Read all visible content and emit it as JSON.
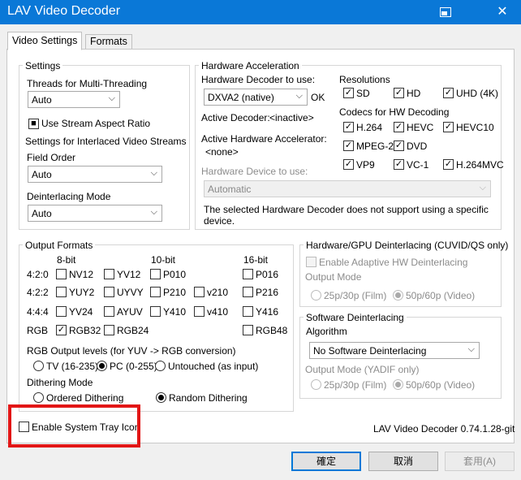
{
  "window": {
    "title": "LAV Video Decoder",
    "close": "✕"
  },
  "tabs": [
    {
      "label": "Video Settings"
    },
    {
      "label": "Formats"
    }
  ],
  "settings": {
    "title": "Settings",
    "threads_label": "Threads for Multi-Threading",
    "threads_value": "Auto",
    "stream_aspect_label": "Use Stream Aspect Ratio",
    "interlaced_label": "Settings for Interlaced Video Streams",
    "field_order_label": "Field Order",
    "field_order_value": "Auto",
    "deint_mode_label": "Deinterlacing Mode",
    "deint_mode_value": "Auto"
  },
  "hwaccel": {
    "title": "Hardware Acceleration",
    "decoder_label": "Hardware Decoder to use:",
    "decoder_value": "DXVA2 (native)",
    "decoder_status": "OK",
    "active_decoder_label": "Active Decoder:",
    "active_decoder_value": "<inactive>",
    "active_accel_label": "Active Hardware Accelerator:",
    "active_accel_value": "<none>",
    "device_label": "Hardware Device to use:",
    "device_value": "Automatic",
    "note": "The selected Hardware Decoder does not support using a specific device.",
    "resolutions_title": "Resolutions",
    "resolutions": [
      "SD",
      "HD",
      "UHD (4K)"
    ],
    "codecs_title": "Codecs for HW Decoding",
    "codecs": [
      "H.264",
      "HEVC",
      "HEVC10",
      "MPEG-2",
      "DVD",
      "VP9",
      "VC-1",
      "H.264MVC"
    ]
  },
  "output": {
    "title": "Output Formats",
    "col_8bit": "8-bit",
    "col_10bit": "10-bit",
    "col_16bit": "16-bit",
    "rows": [
      "4:2:0",
      "4:2:2",
      "4:4:4",
      "RGB"
    ],
    "formats": [
      "NV12",
      "YV12",
      "P010",
      "P016",
      "YUY2",
      "UYVY",
      "P210",
      "v210",
      "P216",
      "YV24",
      "AYUV",
      "Y410",
      "v410",
      "Y416",
      "RGB32",
      "RGB24",
      "RGB48"
    ],
    "rgb_levels_label": "RGB Output levels (for YUV -> RGB conversion)",
    "rgb_levels": [
      "TV (16-235)",
      "PC (0-255)",
      "Untouched (as input)"
    ],
    "dither_label": "Dithering Mode",
    "dither": [
      "Ordered Dithering",
      "Random Dithering"
    ]
  },
  "hwdeint": {
    "title": "Hardware/GPU Deinterlacing (CUVID/QS only)",
    "enable_label": "Enable Adaptive HW Deinterlacing",
    "output_mode_label": "Output Mode",
    "modes": [
      "25p/30p (Film)",
      "50p/60p (Video)"
    ]
  },
  "swdeint": {
    "title": "Software Deinterlacing",
    "algorithm_label": "Algorithm",
    "algorithm_value": "No Software Deinterlacing",
    "output_mode_label": "Output Mode (YADIF only)",
    "modes": [
      "25p/30p (Film)",
      "50p/60p (Video)"
    ]
  },
  "tray_label": "Enable System Tray Icon",
  "version": "LAV Video Decoder 0.74.1.28-git",
  "buttons": {
    "ok": "確定",
    "cancel": "取消",
    "apply": "套用(A)"
  }
}
